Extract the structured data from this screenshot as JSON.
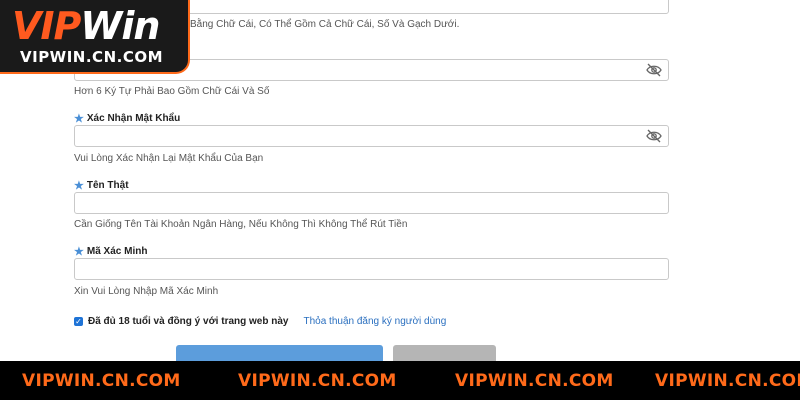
{
  "form": {
    "top_hint": "Bằng Chữ Cái, Có Thể Gồm Cả Chữ Cái, Số Và Gạch Dưới.",
    "password_hint": "Hơn 6 Ký Tự Phải Bao Gồm Chữ Cái Và Số",
    "confirm_label": "Xác Nhận Mật Khẩu",
    "confirm_hint": "Vui Lòng Xác Nhận Lại Mật Khẩu Của Bạn",
    "realname_label": "Tên Thật",
    "realname_hint": "Cần Giống Tên Tài Khoản Ngân Hàng, Nếu Không Thì Không Thể Rút Tiền",
    "code_label": "Mã Xác Minh",
    "code_hint": "Xin Vui Lòng Nhập Mã Xác Minh",
    "agree_text": "Đã đủ 18 tuổi và đồng ý với trang web này",
    "agree_link": "Thỏa thuận đăng ký người dùng",
    "agree_checked": true
  },
  "logo": {
    "vip": "VIP",
    "win": "Win",
    "sub": "VIPWIN.CN.COM"
  },
  "watermarks": [
    "VIPWIN.CN.COM",
    "VIPWIN.CN.COM",
    "VIPWIN.CN.COM",
    "VIPWIN.CN.COM"
  ],
  "colors": {
    "accent": "#4a8fd6",
    "brand": "#ff6a1a",
    "link": "#2a6fbf"
  }
}
